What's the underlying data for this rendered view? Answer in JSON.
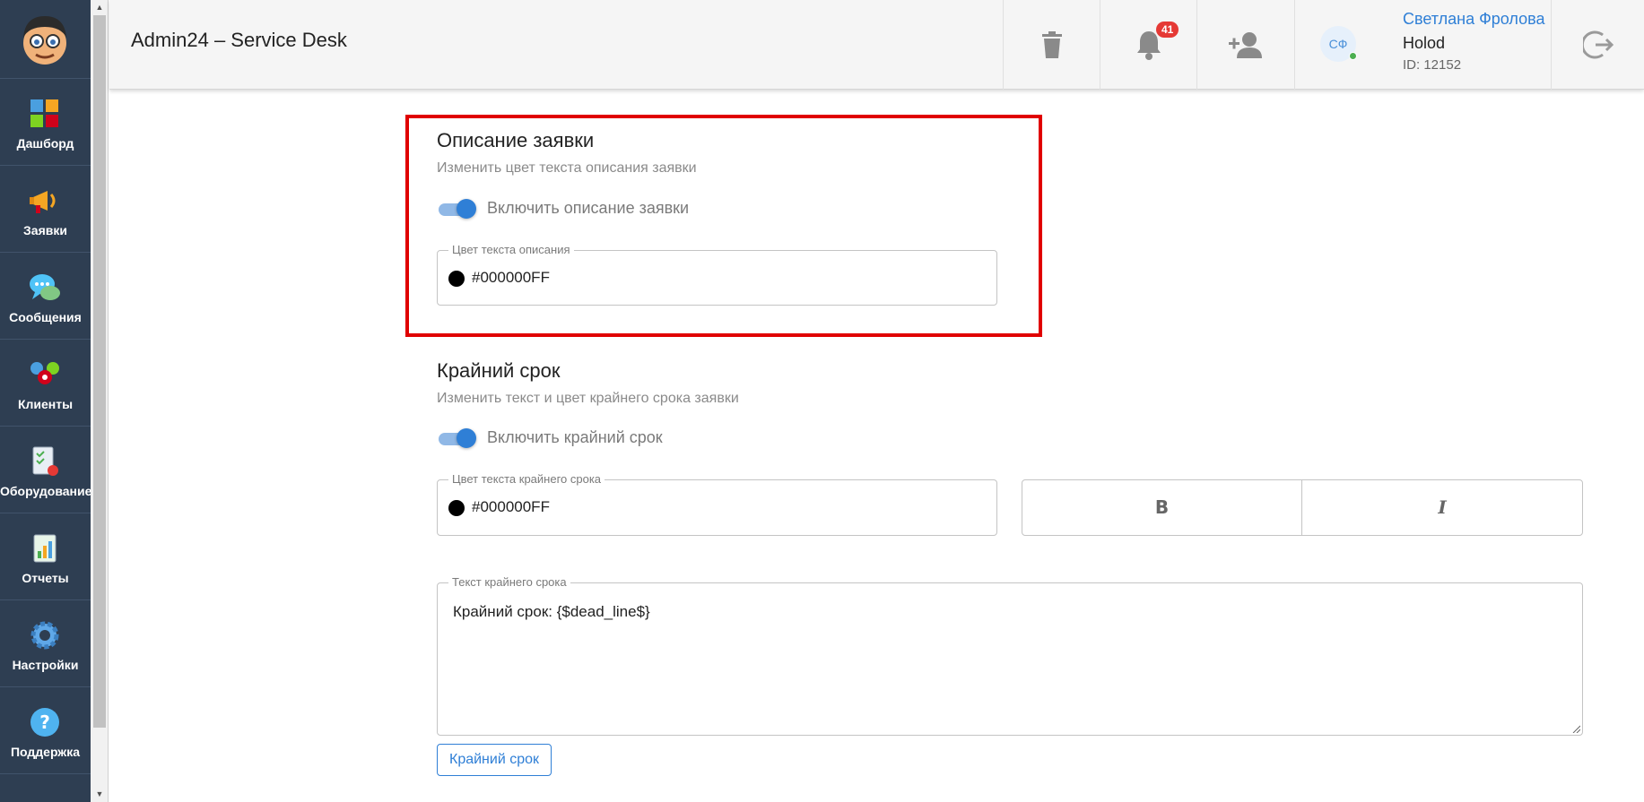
{
  "app": {
    "title": "Admin24 – Service Desk"
  },
  "sidebar": {
    "items": [
      {
        "label": "Дашборд",
        "icon": "dashboard-icon"
      },
      {
        "label": "Заявки",
        "icon": "megaphone-icon"
      },
      {
        "label": "Сообщения",
        "icon": "chat-icon"
      },
      {
        "label": "Клиенты",
        "icon": "clients-icon"
      },
      {
        "label": "Оборудование",
        "icon": "equipment-icon"
      },
      {
        "label": "Отчеты",
        "icon": "reports-icon"
      },
      {
        "label": "Настройки",
        "icon": "gear-icon"
      },
      {
        "label": "Поддержка",
        "icon": "help-icon"
      }
    ]
  },
  "header": {
    "notifications_count": "41",
    "user": {
      "initials": "СФ",
      "name": "Светлана Фролова",
      "org": "Holod",
      "id": "ID: 12152"
    }
  },
  "description": {
    "title": "Описание заявки",
    "subtitle": "Изменить цвет текста описания заявки",
    "toggle_label": "Включить описание заявки",
    "toggle_on": true,
    "color_legend": "Цвет текста описания",
    "color_value": "#000000FF",
    "color_swatch": "#000000"
  },
  "deadline": {
    "title": "Крайний срок",
    "subtitle": "Изменить текст и цвет крайнего срока заявки",
    "toggle_label": "Включить крайний срок",
    "toggle_on": true,
    "color_legend": "Цвет текста крайнего срока",
    "color_value": "#000000FF",
    "bold_label": "B",
    "italic_label": "I",
    "text_legend": "Текст крайнего срока",
    "text_value": "Крайний срок: {$dead_line$}",
    "insert_button": "Крайний срок"
  },
  "colors": {
    "sidebar_bg": "#2e3e52",
    "accent": "#2f7fd6",
    "highlight_border": "#e00000",
    "badge": "#e53935"
  }
}
